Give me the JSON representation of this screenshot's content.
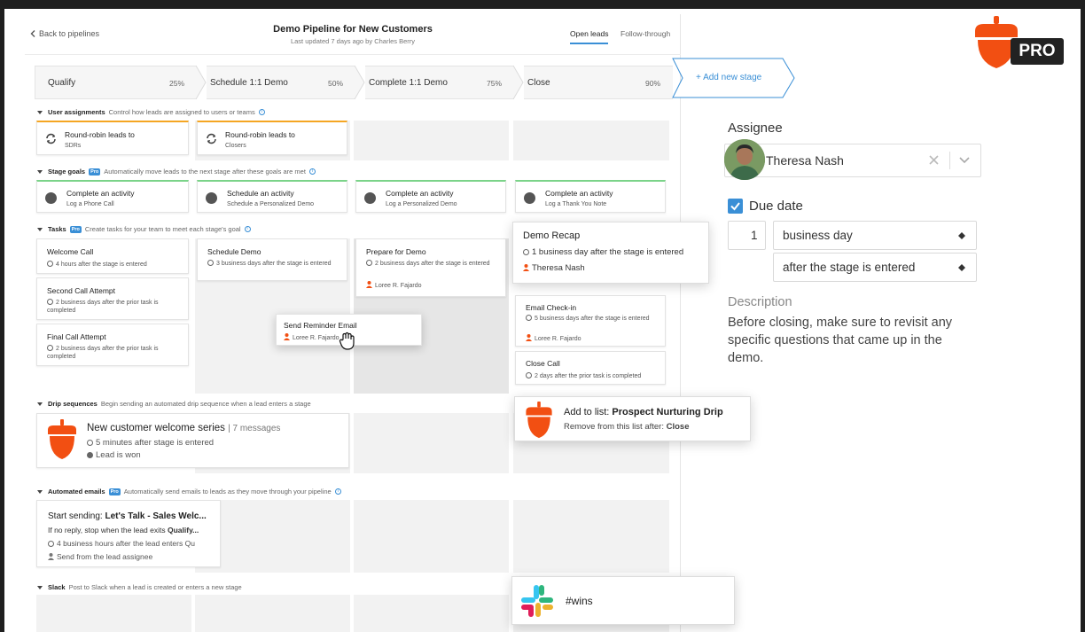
{
  "header": {
    "back_label": "Back to pipelines",
    "title": "Demo Pipeline for New Customers",
    "subtitle": "Last updated 7 days ago by Charles Berry",
    "tabs": [
      {
        "label": "Open leads"
      },
      {
        "label": "Follow-through"
      }
    ]
  },
  "stages": [
    {
      "name": "Qualify",
      "percent": "25%"
    },
    {
      "name": "Schedule 1:1 Demo",
      "percent": "50%"
    },
    {
      "name": "Complete 1:1 Demo",
      "percent": "75%"
    },
    {
      "name": "Close",
      "percent": "90%"
    }
  ],
  "add_stage_label": "+ Add new stage",
  "sections": {
    "user_assignments": {
      "title": "User assignments",
      "desc": "Control how leads are assigned to users or teams"
    },
    "stage_goals": {
      "title": "Stage goals",
      "badge": "Pro",
      "desc": "Automatically move leads to the next stage after these goals are met"
    },
    "tasks": {
      "title": "Tasks",
      "badge": "Pro",
      "desc": "Create tasks for your team to meet each stage's goal"
    },
    "drip": {
      "title": "Drip sequences",
      "desc": "Begin sending an automated drip sequence when a lead enters a stage"
    },
    "emails": {
      "title": "Automated emails",
      "badge": "Pro",
      "desc": "Automatically send emails to leads as they move through your pipeline"
    },
    "slack": {
      "title": "Slack",
      "desc": "Post to Slack when a lead is created or enters a new stage"
    }
  },
  "assignments": [
    {
      "title": "Round-robin leads to",
      "sub": "SDRs"
    },
    {
      "title": "Round-robin leads to",
      "sub": "Closers"
    }
  ],
  "goals": [
    {
      "title": "Complete an activity",
      "sub": "Log a Phone Call"
    },
    {
      "title": "Schedule an activity",
      "sub": "Schedule a Personalized Demo"
    },
    {
      "title": "Complete an activity",
      "sub": "Log a Personalized Demo"
    },
    {
      "title": "Complete an activity",
      "sub": "Log a Thank You Note"
    }
  ],
  "tasks": {
    "welcome_call": {
      "title": "Welcome Call",
      "time": "4 hours after the stage is entered"
    },
    "second_call": {
      "title": "Second Call Attempt",
      "time": "2 business days after the prior task is completed"
    },
    "final_call": {
      "title": "Final Call Attempt",
      "time": "2 business days after the prior task is completed"
    },
    "schedule_demo": {
      "title": "Schedule Demo",
      "time": "3 business days after the stage is entered"
    },
    "prepare_demo": {
      "title": "Prepare for Demo",
      "time": "2 business days after the stage is entered",
      "person": "Loree R. Fajardo"
    },
    "reminder": {
      "title": "Send Reminder Email",
      "person": "Loree R. Fajardo"
    },
    "demo_recap": {
      "title": "Demo Recap",
      "time": "1 business day after the stage is entered",
      "person": "Theresa Nash"
    },
    "email_checkin": {
      "title": "Email Check-in",
      "time": "5 business days after the stage is entered",
      "person": "Loree R. Fajardo"
    },
    "close_call": {
      "title": "Close Call",
      "time": "2 days after the prior task is completed"
    }
  },
  "drip_card": {
    "title": "New customer welcome series",
    "count": "| 7 messages",
    "timing": "5 minutes after stage is entered",
    "condition": "Lead is won"
  },
  "list_popup": {
    "prefix": "Add to list: ",
    "list_name": "Prospect Nurturing Drip",
    "remove_prefix": "Remove from this list after: ",
    "remove_stage": "Close"
  },
  "email_card": {
    "title_prefix": "Start sending: ",
    "title_bold": "Let's Talk - Sales Welc...",
    "line2_prefix": "If no reply, stop when the lead exits ",
    "line2_bold": "Qualify...",
    "timing": "4 business hours after the lead enters Qu",
    "sender": "Send from the lead assignee"
  },
  "slack_popup": {
    "channel": "#wins"
  },
  "pro_logo": "PRO",
  "right_panel": {
    "assignee_label": "Assignee",
    "assignee_name": "Theresa Nash",
    "due_date_label": "Due date",
    "due_number": "1",
    "due_unit": "business day",
    "due_relative": "after the stage is entered",
    "description_label": "Description",
    "description_text": "Before closing, make sure to revisit any specific questions that came up in the demo."
  },
  "colors": {
    "accent": "#3a8fd6",
    "brand_orange": "#f24f12",
    "goal_green": "#7bd389",
    "assign_orange": "#f5a623"
  }
}
